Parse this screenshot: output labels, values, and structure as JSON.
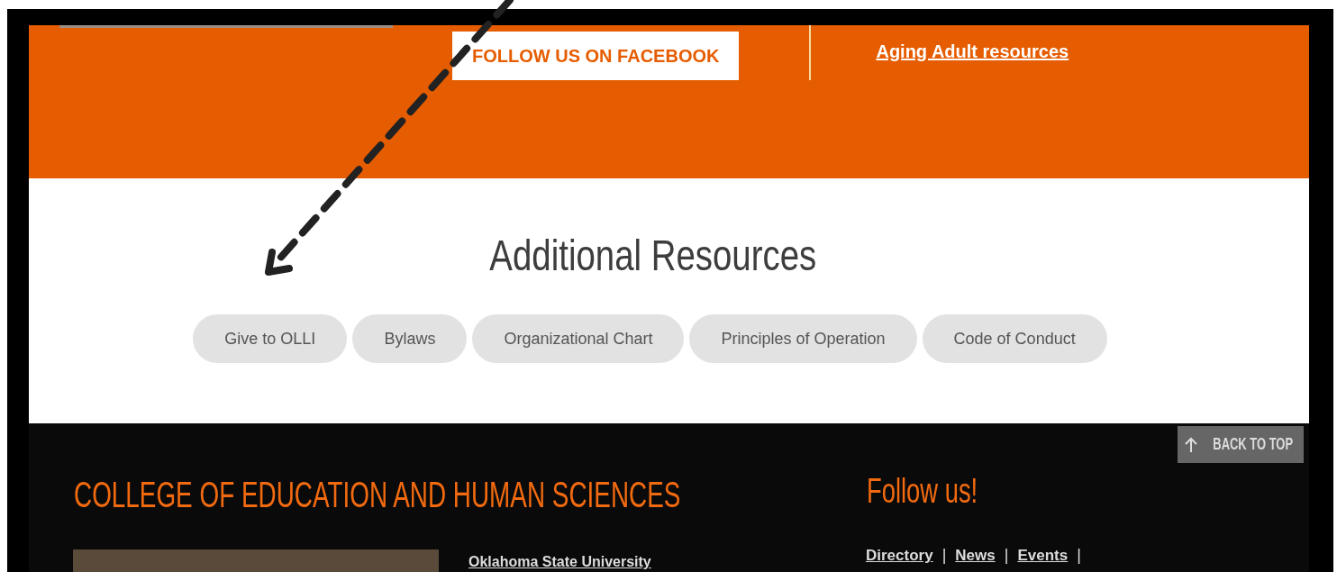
{
  "banner": {
    "facebook_button": "FOLLOW US ON FACEBOOK",
    "links": [
      "Aging Adult resources"
    ]
  },
  "resources": {
    "title": "Additional Resources",
    "buttons": [
      "Give to OLLI",
      "Bylaws",
      "Organizational Chart",
      "Principles of Operation",
      "Code of Conduct"
    ]
  },
  "footer": {
    "back_to_top": "BACK TO TOP",
    "college_title": "COLLEGE OF EDUCATION AND HUMAN SCIENCES",
    "address_lines": [
      "Oklahoma State University"
    ],
    "follow_title": "Follow us!",
    "links": [
      "Directory",
      "News",
      "Events"
    ],
    "separator": "|"
  }
}
